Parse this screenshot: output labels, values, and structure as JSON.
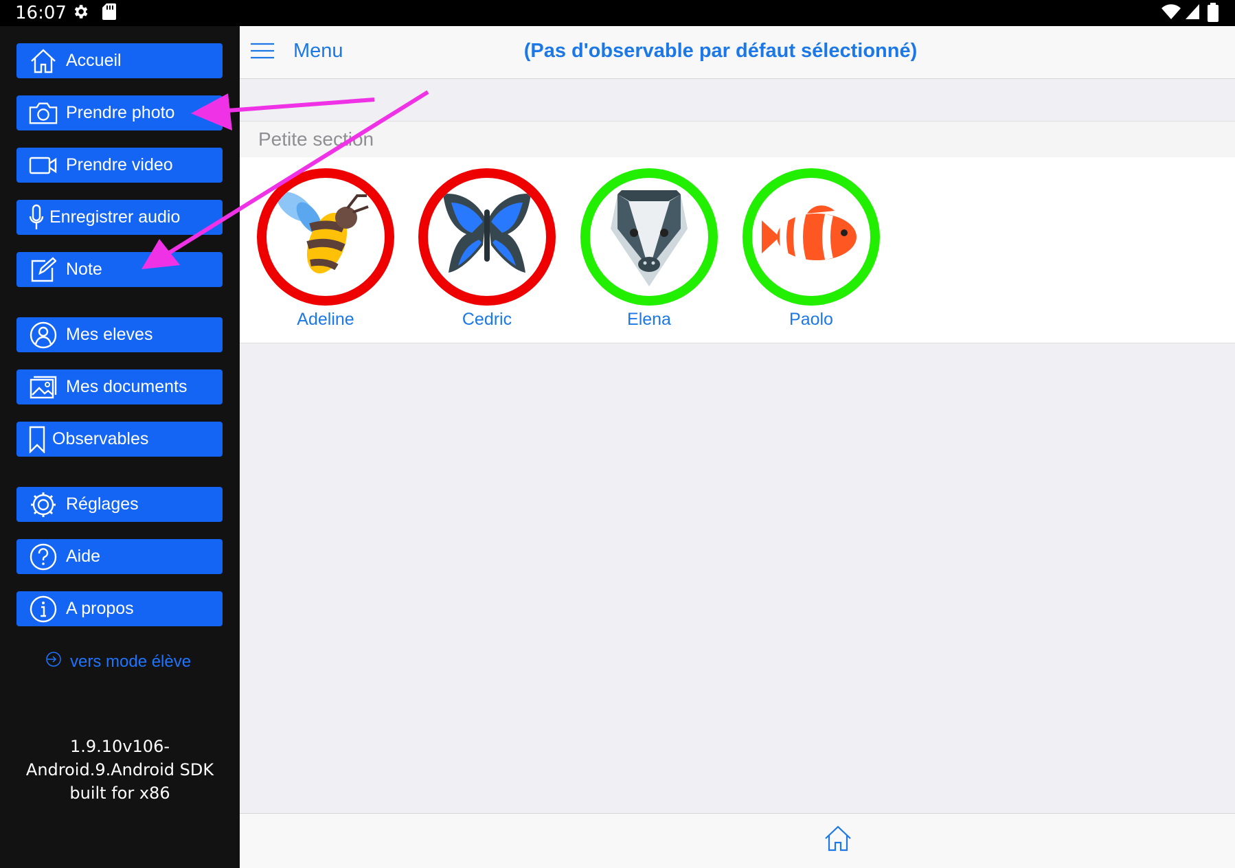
{
  "status_bar": {
    "time": "16:07"
  },
  "sidebar": {
    "items": [
      {
        "label": "Accueil",
        "icon": "home-icon"
      },
      {
        "label": "Prendre photo",
        "icon": "camera-icon"
      },
      {
        "label": "Prendre video",
        "icon": "video-camera-icon"
      },
      {
        "label": "Enregistrer audio",
        "icon": "microphone-icon"
      },
      {
        "label": "Note",
        "icon": "edit-note-icon"
      },
      {
        "label": "Mes eleves",
        "icon": "students-icon"
      },
      {
        "label": "Mes documents",
        "icon": "documents-icon"
      },
      {
        "label": "Observables",
        "icon": "bookmark-icon"
      },
      {
        "label": "Réglages",
        "icon": "gear-icon"
      },
      {
        "label": "Aide",
        "icon": "help-icon"
      },
      {
        "label": "A propos",
        "icon": "info-icon"
      }
    ],
    "mode_link": "vers mode élève",
    "version_lines": [
      "1.9.10v106-",
      "Android.9.Android SDK",
      "built for x86"
    ]
  },
  "header": {
    "menu_label": "Menu",
    "title": "(Pas d'observable par défaut sélectionné)"
  },
  "section": {
    "title": "Petite section"
  },
  "students": [
    {
      "name": "Adeline",
      "avatar": "bee",
      "ring_color": "#ee0000"
    },
    {
      "name": "Cedric",
      "avatar": "butterfly",
      "ring_color": "#ee0000"
    },
    {
      "name": "Elena",
      "avatar": "badger",
      "ring_color": "#22ee00"
    },
    {
      "name": "Paolo",
      "avatar": "clownfish",
      "ring_color": "#22ee00"
    }
  ],
  "colors": {
    "accent": "#1565f5",
    "link": "#1b78e6",
    "annotation": "#f032e6"
  }
}
